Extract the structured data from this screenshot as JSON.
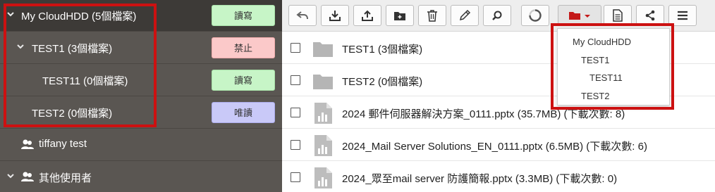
{
  "sidebar": {
    "root": {
      "label": "My CloudHDD (5個檔案)",
      "permission": "讀寫"
    },
    "children": [
      {
        "label": "TEST1 (3個檔案)",
        "permission": "禁止"
      },
      {
        "label": "TEST11 (0個檔案)",
        "permission": "讀寫"
      },
      {
        "label": "TEST2 (0個檔案)",
        "permission": "唯讀"
      }
    ],
    "users": [
      {
        "label": "tiffany test"
      },
      {
        "label": "其他使用者"
      }
    ]
  },
  "toolbar": {
    "buttons": [
      "back-icon",
      "download-icon",
      "upload-icon",
      "new-folder-icon",
      "trash-icon",
      "pencil-icon",
      "search-icon",
      "spinner-icon",
      "folder-move-icon",
      "document-icon",
      "share-icon",
      "menu-icon"
    ]
  },
  "files": [
    {
      "name": "TEST1 (3個檔案)",
      "kind": "folder"
    },
    {
      "name": "TEST2 (0個檔案)",
      "kind": "folder"
    },
    {
      "name": "2024 郵件伺服器解決方案_0111.pptx (35.7MB) (下載次數: 8)",
      "kind": "file"
    },
    {
      "name": "2024_Mail Server Solutions_EN_0111.pptx (6.5MB) (下載次數: 6)",
      "kind": "file"
    },
    {
      "name": "2024_眾至mail server 防護簡報.pptx (3.3MB) (下載次數: 0)",
      "kind": "file"
    }
  ],
  "dropdown": {
    "items": [
      "My CloudHDD",
      "TEST1",
      "TEST11",
      "TEST2"
    ]
  },
  "colors": {
    "sidebar_bg": "#5a5652",
    "sidebar_root_bg": "#3d3a37",
    "highlight": "#cc1111",
    "readwrite": "#c7f5c7",
    "deny": "#fbc9c9",
    "readonly": "#c9c9f8",
    "folder_accent": "#c41a1a"
  }
}
